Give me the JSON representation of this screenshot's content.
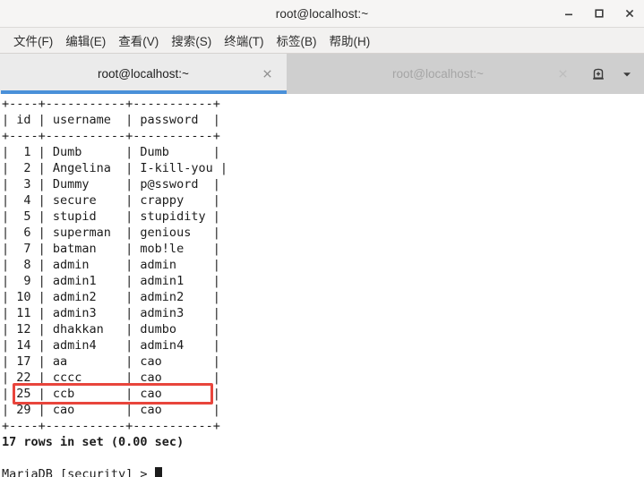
{
  "window": {
    "title": "root@localhost:~",
    "controls": [
      {
        "name": "minimize",
        "glyph": "minimize-icon"
      },
      {
        "name": "maximize",
        "glyph": "maximize-icon"
      },
      {
        "name": "close",
        "glyph": "close-icon"
      }
    ]
  },
  "menubar": {
    "items": [
      {
        "label": "文件(F)"
      },
      {
        "label": "编辑(E)"
      },
      {
        "label": "查看(V)"
      },
      {
        "label": "搜索(S)"
      },
      {
        "label": "终端(T)"
      },
      {
        "label": "标签(B)"
      },
      {
        "label": "帮助(H)"
      }
    ]
  },
  "tabbar": {
    "tabs": [
      {
        "label": "root@localhost:~",
        "active": true
      },
      {
        "label": "root@localhost:~",
        "active": false
      }
    ],
    "actions": [
      {
        "name": "new-tab-icon"
      },
      {
        "name": "tab-list-chevron-down-icon"
      }
    ]
  },
  "terminal": {
    "table": {
      "separator": "+----+-----------+-----------+",
      "header": "| id | username  | password  |",
      "rows": [
        "|  1 | Dumb      | Dumb      |",
        "|  2 | Angelina  | I-kill-you |",
        "|  3 | Dummy     | p@ssword  |",
        "|  4 | secure    | crappy    |",
        "|  5 | stupid    | stupidity |",
        "|  6 | superman  | genious   |",
        "|  7 | batman    | mob!le    |",
        "|  8 | admin     | admin     |",
        "|  9 | admin1    | admin1    |",
        "| 10 | admin2    | admin2    |",
        "| 11 | admin3    | admin3    |",
        "| 12 | dhakkan   | dumbo     |",
        "| 14 | admin4    | admin4    |",
        "| 17 | aa        | cao       |",
        "| 22 | cccc      | cao       |",
        "| 25 | ccb       | cao       |",
        "| 29 | cao       | cao       |"
      ]
    },
    "result_line": "17 rows in set (0.00 sec)",
    "prompt": "MariaDB [security] > ",
    "highlight": {
      "target_row_index": 15,
      "color": "#e8453c"
    }
  },
  "colors": {
    "titlebar_bg": "#f6f5f4",
    "menubar_bg": "#f2f1f0",
    "tabbar_bg": "#cfcfcf",
    "active_tab_bg": "#ebebeb",
    "tab_accent": "#4a90d9",
    "terminal_bg": "#ffffff",
    "terminal_fg": "#1c1c1c",
    "highlight": "#e8453c"
  }
}
